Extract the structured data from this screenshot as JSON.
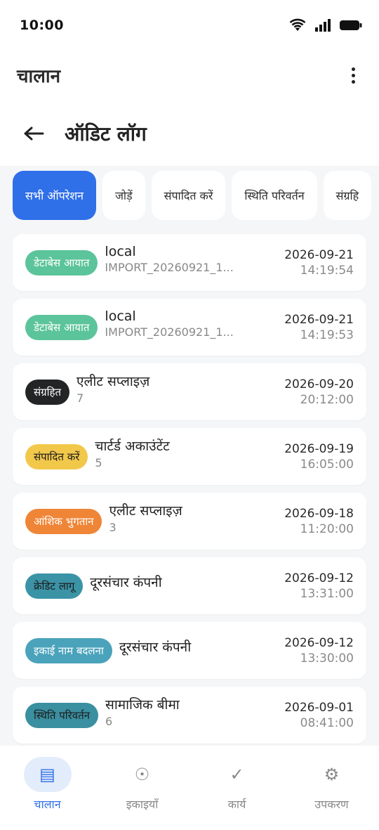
{
  "status_bar": {
    "time": "10:00"
  },
  "app_bar": {
    "title": "चालान"
  },
  "page": {
    "title": "ऑडिट लॉग"
  },
  "filters": [
    {
      "label": "सभी ऑपरेशन",
      "active": true
    },
    {
      "label": "जोड़ें",
      "active": false
    },
    {
      "label": "संपादित करें",
      "active": false
    },
    {
      "label": "स्थिति परिवर्तन",
      "active": false
    },
    {
      "label": "संग्रहि",
      "active": false
    }
  ],
  "entries": [
    {
      "badge": "डेटाबेस आयात",
      "badge_color": "#5cc49a",
      "title": "local",
      "subtitle": "IMPORT_20260921_1...",
      "date": "2026-09-21",
      "time": "14:19:54"
    },
    {
      "badge": "डेटाबेस आयात",
      "badge_color": "#5cc49a",
      "title": "local",
      "subtitle": "IMPORT_20260921_1...",
      "date": "2026-09-21",
      "time": "14:19:53"
    },
    {
      "badge": "संग्रहित",
      "badge_color": "#222426",
      "title": "एलीट सप्लाइज़",
      "subtitle": "7",
      "date": "2026-09-20",
      "time": "20:12:00"
    },
    {
      "badge": "संपादित करें",
      "badge_color": "#f2c84b",
      "title": "चार्टर्ड अकाउंटेंट",
      "subtitle": "5",
      "date": "2026-09-19",
      "time": "16:05:00"
    },
    {
      "badge": "आंशिक भुगतान",
      "badge_color": "#ef8536",
      "title": "एलीट सप्लाइज़",
      "subtitle": "3",
      "date": "2026-09-18",
      "time": "11:20:00"
    },
    {
      "badge": "क्रेडिट लागू",
      "badge_color": "#3b93a6",
      "title": "दूरसंचार कंपनी",
      "subtitle": "",
      "date": "2026-09-12",
      "time": "13:31:00"
    },
    {
      "badge": "इकाई नाम बदलना",
      "badge_color": "#4aa3bb",
      "title": "दूरसंचार कंपनी",
      "subtitle": "",
      "date": "2026-09-12",
      "time": "13:30:00"
    },
    {
      "badge": "स्थिति परिवर्तन",
      "badge_color": "#3a8fa0",
      "title": "सामाजिक बीमा",
      "subtitle": "6",
      "date": "2026-09-01",
      "time": "08:41:00"
    }
  ],
  "bottom_nav": [
    {
      "label": "चालान",
      "icon": "invoice-list-icon",
      "glyph": "▤",
      "active": true
    },
    {
      "label": "इकाइयाँ",
      "icon": "entities-icon",
      "glyph": "☉",
      "active": false
    },
    {
      "label": "कार्य",
      "icon": "tasks-check-icon",
      "glyph": "✓",
      "active": false
    },
    {
      "label": "उपकरण",
      "icon": "tools-gear-icon",
      "glyph": "⚙",
      "active": false
    }
  ],
  "colors": {
    "accent": "#2f6fe8",
    "background": "#f5f6f8"
  }
}
